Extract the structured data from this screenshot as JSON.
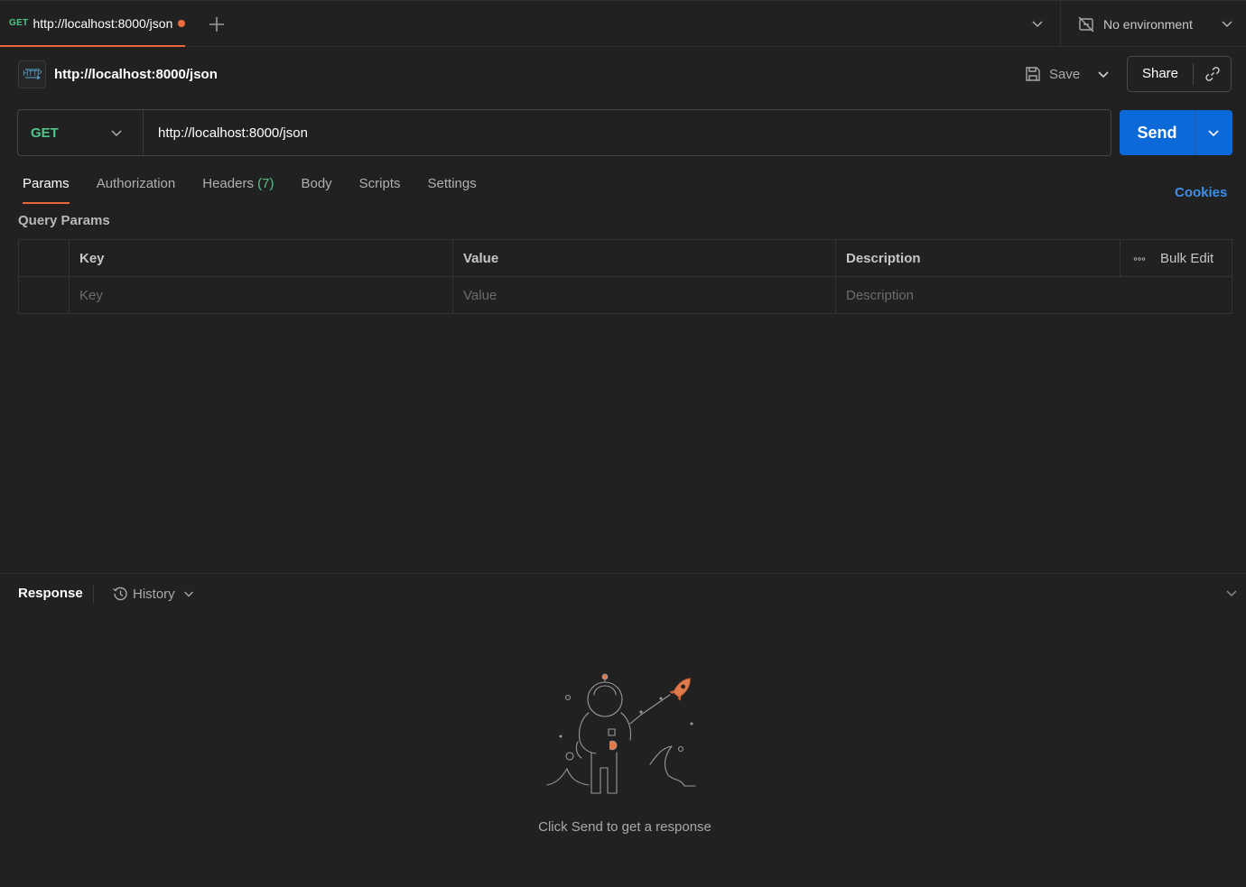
{
  "tab": {
    "method": "GET",
    "title": "http://localhost:8000/json",
    "add_icon": "plus-icon"
  },
  "environment": {
    "label": "No environment",
    "icon": "no-environment-icon"
  },
  "request": {
    "icon": "http-icon",
    "title": "http://localhost:8000/json",
    "save_label": "Save",
    "share_label": "Share",
    "method": "GET",
    "url": "http://localhost:8000/json",
    "send_label": "Send"
  },
  "request_tabs": [
    {
      "label": "Params",
      "count": "",
      "active": true
    },
    {
      "label": "Authorization",
      "count": ""
    },
    {
      "label": "Headers",
      "count": "(7)"
    },
    {
      "label": "Body",
      "count": ""
    },
    {
      "label": "Scripts",
      "count": ""
    },
    {
      "label": "Settings",
      "count": ""
    }
  ],
  "cookies_label": "Cookies",
  "query_params": {
    "label": "Query Params",
    "columns": [
      "Key",
      "Value",
      "Description"
    ],
    "bulk_edit_label": "Bulk Edit",
    "placeholders": {
      "key": "Key",
      "value": "Value",
      "description": "Description"
    }
  },
  "response": {
    "title": "Response",
    "history_label": "History",
    "empty_hint": "Click Send to get a response"
  },
  "colors": {
    "accent": "#e8663a",
    "method_get": "#4fc48a",
    "send": "#0b6ad8",
    "link": "#3f8fe8"
  }
}
